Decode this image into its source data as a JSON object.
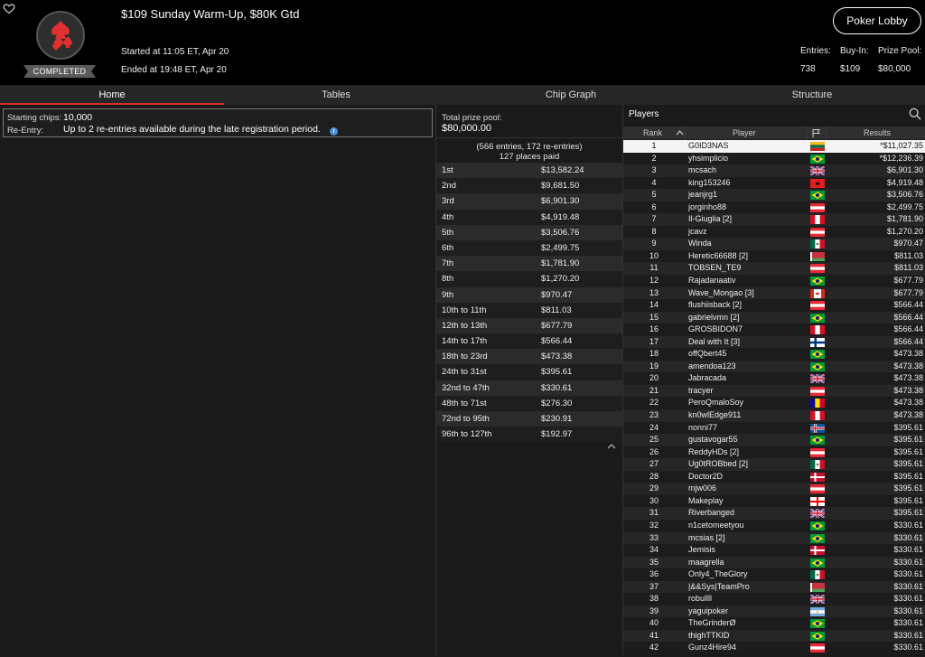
{
  "header": {
    "title": "$109 Sunday Warm-Up, $80K Gtd",
    "started": "Started at 11:05 ET, Apr 20",
    "ended": "Ended at 19:48 ET, Apr 20",
    "status_badge": "COMPLETED",
    "lobby_button": "Poker Lobby",
    "stats": [
      {
        "label": "Entries:",
        "value": "738"
      },
      {
        "label": "Buy-In:",
        "value": "$109"
      },
      {
        "label": "Prize Pool:",
        "value": "$80,000"
      }
    ]
  },
  "tabs": [
    "Home",
    "Tables",
    "Chip Graph",
    "Structure"
  ],
  "info": {
    "starting_chips_label": "Starting chips:",
    "starting_chips_value": "10,000",
    "reentry_label": "Re-Entry:",
    "reentry_value": "Up to 2 re-entries available during the late registration period."
  },
  "prize": {
    "total_label": "Total prize pool:",
    "total_value": "$80,000.00",
    "entries_note": "(566 entries, 172 re-entries)",
    "places_note": "127 places paid",
    "rows": [
      {
        "place": "1st",
        "amount": "$13,582.24"
      },
      {
        "place": "2nd",
        "amount": "$9,681.50"
      },
      {
        "place": "3rd",
        "amount": "$6,901.30"
      },
      {
        "place": "4th",
        "amount": "$4,919.48"
      },
      {
        "place": "5th",
        "amount": "$3,506.76"
      },
      {
        "place": "6th",
        "amount": "$2,499.75"
      },
      {
        "place": "7th",
        "amount": "$1,781.90"
      },
      {
        "place": "8th",
        "amount": "$1,270.20"
      },
      {
        "place": "9th",
        "amount": "$970.47"
      },
      {
        "place": "10th to 11th",
        "amount": "$811.03"
      },
      {
        "place": "12th to 13th",
        "amount": "$677.79"
      },
      {
        "place": "14th to 17th",
        "amount": "$566.44"
      },
      {
        "place": "18th to 23rd",
        "amount": "$473.38"
      },
      {
        "place": "24th to 31st",
        "amount": "$395.61"
      },
      {
        "place": "32nd to 47th",
        "amount": "$330.61"
      },
      {
        "place": "48th to 71st",
        "amount": "$276.30"
      },
      {
        "place": "72nd to 95th",
        "amount": "$230.91"
      },
      {
        "place": "96th to 127th",
        "amount": "$192.97"
      }
    ]
  },
  "players": {
    "title": "Players",
    "columns": {
      "rank": "Rank",
      "player": "Player",
      "results": "Results"
    },
    "rows": [
      {
        "rank": "1",
        "name": "G0ID3NAS",
        "flag": "lithuania",
        "result": "*$11,027.35"
      },
      {
        "rank": "2",
        "name": "yhsimplicio",
        "flag": "brazil",
        "result": "*$12,236.39"
      },
      {
        "rank": "3",
        "name": "mcsach",
        "flag": "uk",
        "result": "$6,901.30"
      },
      {
        "rank": "4",
        "name": "king153246",
        "flag": "albania",
        "result": "$4,919.48"
      },
      {
        "rank": "5",
        "name": "jeanjrg1",
        "flag": "brazil",
        "result": "$3,506.76"
      },
      {
        "rank": "6",
        "name": "jorginho88",
        "flag": "austria",
        "result": "$2,499.75"
      },
      {
        "rank": "7",
        "name": "Il-Giuglia [2]",
        "flag": "peru",
        "result": "$1,781.90"
      },
      {
        "rank": "8",
        "name": "jcavz",
        "flag": "austria",
        "result": "$1,270.20"
      },
      {
        "rank": "9",
        "name": "Winda",
        "flag": "mexico",
        "result": "$970.47"
      },
      {
        "rank": "10",
        "name": "Heretic66688 [2]",
        "flag": "belarus",
        "result": "$811.03"
      },
      {
        "rank": "11",
        "name": "TOBSEN_TE9",
        "flag": "austria",
        "result": "$811.03"
      },
      {
        "rank": "12",
        "name": "Rajadanaativ",
        "flag": "brazil",
        "result": "$677.79"
      },
      {
        "rank": "13",
        "name": "Wave_Mongao [3]",
        "flag": "canada",
        "result": "$677.79"
      },
      {
        "rank": "14",
        "name": "flushiisback [2]",
        "flag": "austria",
        "result": "$566.44"
      },
      {
        "rank": "15",
        "name": "gabrielvmn [2]",
        "flag": "brazil",
        "result": "$566.44"
      },
      {
        "rank": "16",
        "name": "GROSBIDON7",
        "flag": "peru",
        "result": "$566.44"
      },
      {
        "rank": "17",
        "name": "Deal with It [3]",
        "flag": "finland",
        "result": "$566.44"
      },
      {
        "rank": "18",
        "name": "offQbert45",
        "flag": "brazil",
        "result": "$473.38"
      },
      {
        "rank": "19",
        "name": "amendoa123",
        "flag": "brazil",
        "result": "$473.38"
      },
      {
        "rank": "20",
        "name": "Jabracada",
        "flag": "uk",
        "result": "$473.38"
      },
      {
        "rank": "21",
        "name": "tracyer",
        "flag": "austria",
        "result": "$473.38"
      },
      {
        "rank": "22",
        "name": "PeroQmaloSoy",
        "flag": "andorra",
        "result": "$473.38"
      },
      {
        "rank": "23",
        "name": "kn0wlEdge911",
        "flag": "peru",
        "result": "$473.38"
      },
      {
        "rank": "24",
        "name": "nonni77",
        "flag": "iceland",
        "result": "$395.61"
      },
      {
        "rank": "25",
        "name": "gustavogar55",
        "flag": "brazil",
        "result": "$395.61"
      },
      {
        "rank": "26",
        "name": "ReddyHDs [2]",
        "flag": "austria",
        "result": "$395.61"
      },
      {
        "rank": "27",
        "name": "Ug0tROBbed [2]",
        "flag": "mexico",
        "result": "$395.61"
      },
      {
        "rank": "28",
        "name": "Doctor2D",
        "flag": "denmark",
        "result": "$395.61"
      },
      {
        "rank": "29",
        "name": "mjw006",
        "flag": "austria",
        "result": "$395.61"
      },
      {
        "rank": "30",
        "name": "Makeplay",
        "flag": "georgia",
        "result": "$395.61"
      },
      {
        "rank": "31",
        "name": "Riverbanged",
        "flag": "uk",
        "result": "$395.61"
      },
      {
        "rank": "32",
        "name": "n1cetomeetyou",
        "flag": "brazil",
        "result": "$330.61"
      },
      {
        "rank": "33",
        "name": "mcsias [2]",
        "flag": "brazil",
        "result": "$330.61"
      },
      {
        "rank": "34",
        "name": "Jemisis",
        "flag": "denmark",
        "result": "$330.61"
      },
      {
        "rank": "35",
        "name": "maagrella",
        "flag": "brazil",
        "result": "$330.61"
      },
      {
        "rank": "36",
        "name": "Only4_TheGlory",
        "flag": "mexico",
        "result": "$330.61"
      },
      {
        "rank": "37",
        "name": "|&&Sys|TeamPro",
        "flag": "belarus",
        "result": "$330.61"
      },
      {
        "rank": "38",
        "name": "robullll",
        "flag": "uk",
        "result": "$330.61"
      },
      {
        "rank": "39",
        "name": "yaguipoker",
        "flag": "argentina",
        "result": "$330.61"
      },
      {
        "rank": "40",
        "name": "TheGrinderØ",
        "flag": "brazil",
        "result": "$330.61"
      },
      {
        "rank": "41",
        "name": "thighTTKID",
        "flag": "brazil",
        "result": "$330.61"
      },
      {
        "rank": "42",
        "name": "Gunz4Hire94",
        "flag": "austria",
        "result": "$330.61"
      }
    ]
  },
  "colors": {
    "accent_red": "#d62b2b",
    "header_bg": "#000000",
    "panel_bg": "#1a1a1a",
    "highlight_row": "#f4f4f4"
  }
}
